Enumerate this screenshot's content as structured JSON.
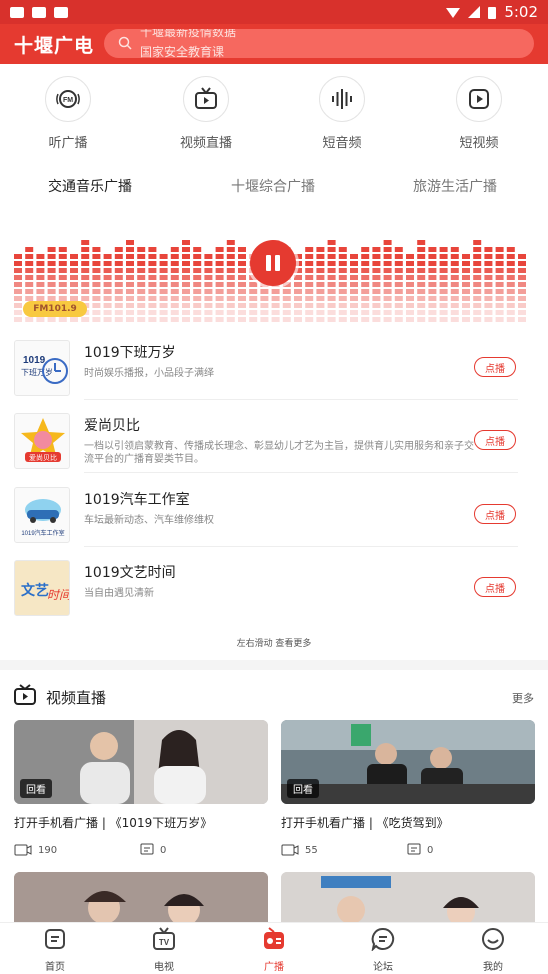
{
  "status_bar": {
    "time": "5:02"
  },
  "header": {
    "logo": "十堰广电",
    "search_rotating_1": "十堰最新疫情数据",
    "search_rotating_2": "国家安全教育课"
  },
  "categories": [
    {
      "label": "听广播",
      "icon": "fm-radio-icon"
    },
    {
      "label": "视频直播",
      "icon": "tv-icon"
    },
    {
      "label": "短音频",
      "icon": "audio-wave-icon"
    },
    {
      "label": "短视频",
      "icon": "video-play-icon"
    }
  ],
  "channels": [
    {
      "label": "交通音乐广播",
      "active": true
    },
    {
      "label": "十堰综合广播",
      "active": false
    },
    {
      "label": "旅游生活广播",
      "active": false
    }
  ],
  "player": {
    "frequency": "FM101.9",
    "state": "playing"
  },
  "programs": [
    {
      "title": "1019下班万岁",
      "desc": "时尚娱乐播报，小品段子满绎",
      "button": "点播",
      "thumb_text": "1019 下班万岁"
    },
    {
      "title": "爱尚贝比",
      "desc": "一档以引领启蒙教育、传播成长理念、彰显幼儿才艺为主旨，提供育儿实用服务和亲子交流平台的广播育婴类节目。",
      "button": "点播",
      "thumb_text": "爱尚贝比"
    },
    {
      "title": "1019汽车工作室",
      "desc": "车坛最新动态、汽车维修维权",
      "button": "点播",
      "thumb_text": "1019汽车工作室"
    },
    {
      "title": "1019文艺时间",
      "desc": "当自由遇见清新",
      "button": "点播",
      "thumb_text": "文艺时间"
    }
  ],
  "hint": "左右滑动 查看更多",
  "video_section": {
    "title": "视频直播",
    "more": "更多",
    "cards": [
      {
        "title": "打开手机看广播 | 《1019下班万岁》",
        "badge": "回看",
        "views": "190",
        "comments": "0"
      },
      {
        "title": "打开手机看广播 | 《吃货驾到》",
        "badge": "回看",
        "views": "55",
        "comments": "0"
      }
    ]
  },
  "tabbar": [
    {
      "label": "首页",
      "icon": "home-icon",
      "active": false
    },
    {
      "label": "电视",
      "icon": "tv-tab-icon",
      "active": false
    },
    {
      "label": "广播",
      "icon": "radio-tab-icon",
      "active": true
    },
    {
      "label": "论坛",
      "icon": "forum-icon",
      "active": false
    },
    {
      "label": "我的",
      "icon": "profile-icon",
      "active": false
    }
  ],
  "colors": {
    "brand": "#e53a30",
    "status_bar": "#d8312c"
  }
}
